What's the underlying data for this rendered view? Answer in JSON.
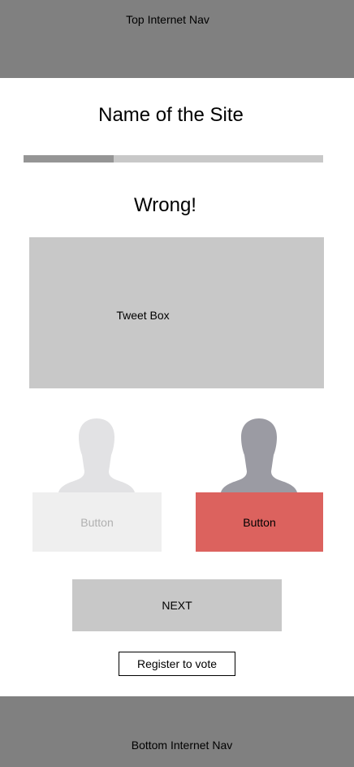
{
  "top_nav": {
    "label": "Top Internet Nav"
  },
  "site": {
    "title": "Name of the Site"
  },
  "progress": {
    "value": 0.3,
    "track_color": "#c8c8c8",
    "fill_color": "#959595"
  },
  "result": {
    "heading": "Wrong!"
  },
  "tweet_box": {
    "label": "Tweet Box"
  },
  "choices": {
    "left": {
      "label": "Button",
      "avatar_icon": "person-silhouette-icon",
      "avatar_color": "#e2e2e4",
      "button_color": "#efefef"
    },
    "right": {
      "label": "Button",
      "avatar_icon": "person-silhouette-icon",
      "avatar_color": "#9b9ba3",
      "button_color": "#dc625e"
    }
  },
  "next_button": {
    "label": "NEXT"
  },
  "register_button": {
    "label": "Register to vote"
  },
  "bottom_nav": {
    "label": "Bottom Internet Nav"
  }
}
